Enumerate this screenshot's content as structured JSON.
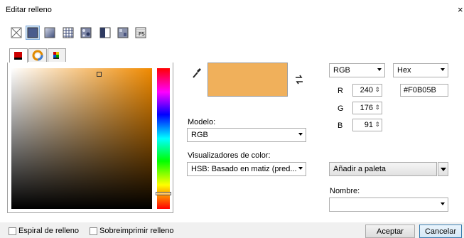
{
  "window": {
    "title": "Editar relleno",
    "close_glyph": "×"
  },
  "fill_types": [
    {
      "icon": "no-fill-icon"
    },
    {
      "icon": "uniform-fill-icon",
      "selected": true
    },
    {
      "icon": "fountain-fill-icon"
    },
    {
      "icon": "vector-pattern-fill-icon"
    },
    {
      "icon": "bitmap-pattern-fill-icon"
    },
    {
      "icon": "two-color-pattern-fill-icon"
    },
    {
      "icon": "texture-fill-icon"
    },
    {
      "icon": "postscript-fill-icon"
    }
  ],
  "viewer_tabs": [
    {
      "icon": "color-viewers-tab-icon",
      "active": true
    },
    {
      "icon": "color-harmonies-tab-icon"
    },
    {
      "icon": "color-palettes-tab-icon"
    }
  ],
  "color": {
    "hex_value": "#F0B05B",
    "swatch": "#f0b05b",
    "hue_level_fraction": 0.11
  },
  "model": {
    "label": "Modelo:",
    "selected": "RGB"
  },
  "viewers": {
    "label": "Visualizadores de color:",
    "selected": "HSB: Basado en matiz (pred..."
  },
  "right": {
    "model_select": "RGB",
    "format_select": "Hex",
    "channels": [
      {
        "name": "R",
        "value": "240"
      },
      {
        "name": "G",
        "value": "176"
      },
      {
        "name": "B",
        "value": "91"
      }
    ],
    "hex": "#F0B05B",
    "add_palette": "Añadir a paleta",
    "name_label": "Nombre:",
    "name_value": ""
  },
  "bottom": {
    "wrap_fill": "Espiral de relleno",
    "overprint_fill": "Sobreimprimir relleno",
    "ok": "Aceptar",
    "cancel": "Cancelar"
  }
}
